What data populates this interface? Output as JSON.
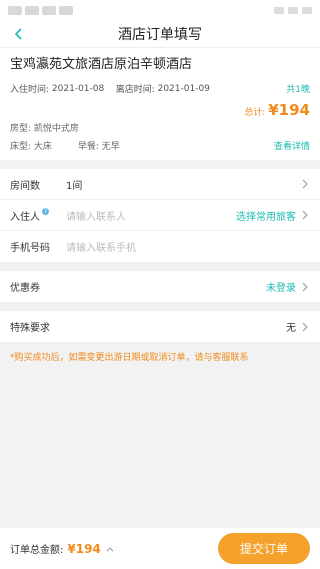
{
  "nav": {
    "title": "酒店订单填写"
  },
  "hotel": {
    "name": "宝鸡瀛苑文旅酒店原泊辛顿酒店",
    "checkin_label": "入住时间:",
    "checkin_date": "2021-01-08",
    "checkout_label": "离店时间:",
    "checkout_date": "2021-01-09",
    "nights": "共1晚",
    "total_label": "总计:",
    "total_amount": "¥194",
    "room_type": "房型: 凯悦中式房",
    "bed_type": "床型: 大床",
    "breakfast": "早餐: 无早",
    "detail_link": "查看详情"
  },
  "form": {
    "rooms_label": "房间数",
    "rooms_value": "1间",
    "guest_label": "入住人",
    "guest_placeholder": "请输入联系人",
    "guest_select": "选择常用旅客",
    "phone_label": "手机号码",
    "phone_placeholder": "请输入联系手机"
  },
  "coupon": {
    "label": "优惠券",
    "value": "未登录"
  },
  "special": {
    "label": "特殊要求",
    "value": "无"
  },
  "notice": "*购买成功后，如需变更出游日期或取消订单，请与客服联系",
  "footer": {
    "label": "订单总金额:",
    "amount": "¥194",
    "submit": "提交订单"
  },
  "colors": {
    "accent": "#1bbcb2",
    "price": "#f18a1b",
    "button": "#f5a22c"
  }
}
